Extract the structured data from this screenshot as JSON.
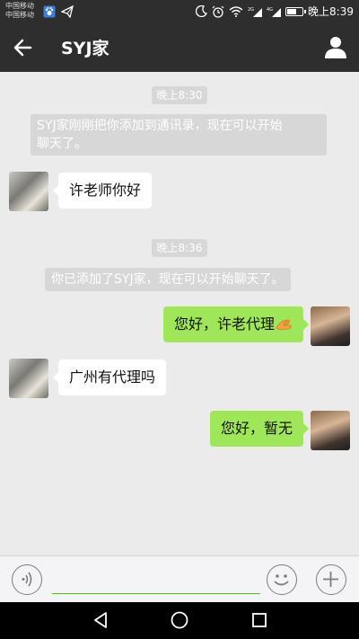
{
  "status_bar": {
    "carrier_1": "中国移动",
    "carrier_2": "中国移动",
    "time": "晚上8:39",
    "signal_1_label": "2G",
    "signal_2_label": "4G",
    "battery_level": 0.65
  },
  "header": {
    "title": "SYJ家",
    "back_icon": "arrow-left-icon",
    "profile_icon": "person-icon"
  },
  "messages": [
    {
      "type": "time",
      "text": "晚上8:30"
    },
    {
      "type": "system",
      "text_line1": "SYJ家刚刚把你添加到通讯录，现在可以开始",
      "text_line2": "聊天了。"
    },
    {
      "type": "received",
      "text": "许老师你好"
    },
    {
      "type": "time",
      "text": "晚上8:36"
    },
    {
      "type": "system",
      "text": "你已添加了SYJ家，现在可以开始聊天了。"
    },
    {
      "type": "sent",
      "text": "您好，许老代理",
      "emoji": "ok-hand-icon"
    },
    {
      "type": "received",
      "text": "广州有代理吗"
    },
    {
      "type": "sent",
      "text": "您好，暂无"
    }
  ],
  "input_bar": {
    "value": "",
    "voice_icon": "voice-icon",
    "emoji_icon": "emoji-icon",
    "plus_icon": "plus-icon",
    "accent_color": "#45c01a"
  },
  "colors": {
    "sent_bubble": "#9fe658",
    "received_bubble": "#ffffff",
    "header_bg": "#2e2e2e",
    "chat_bg": "#ebebeb"
  }
}
